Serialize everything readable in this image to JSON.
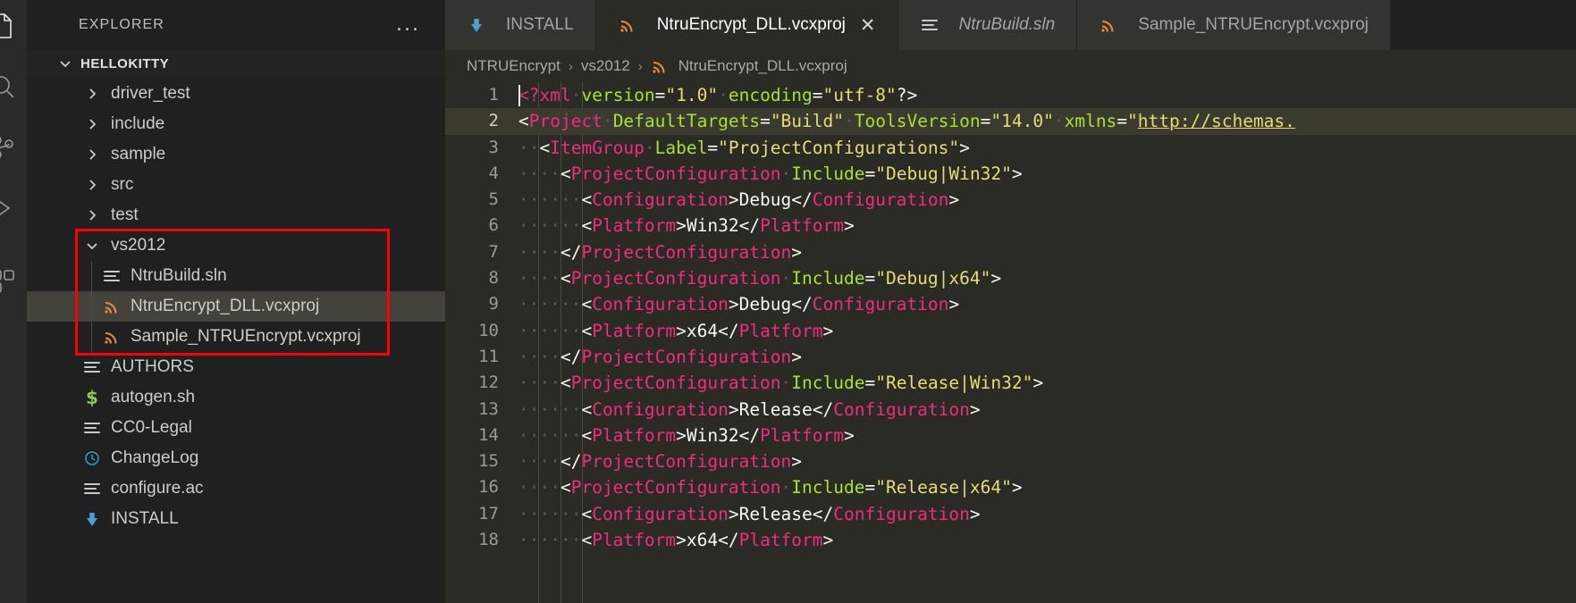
{
  "activity_bar": {
    "items": [
      {
        "name": "explorer-icon",
        "label": "Explorer"
      },
      {
        "name": "search-icon",
        "label": "Search"
      },
      {
        "name": "source-control-icon",
        "label": "Source Control"
      },
      {
        "name": "run-debug-icon",
        "label": "Run and Debug"
      },
      {
        "name": "extensions-icon",
        "label": "Extensions"
      }
    ]
  },
  "sidebar": {
    "title": "EXPLORER",
    "more_actions": "...",
    "root_folder": "HELLOKITTY",
    "tree": [
      {
        "label": "driver_test",
        "icon": "chevron-right-icon",
        "type": "folder",
        "indent": 1,
        "expanded": false,
        "selected": false
      },
      {
        "label": "include",
        "icon": "chevron-right-icon",
        "type": "folder",
        "indent": 1,
        "expanded": false,
        "selected": false
      },
      {
        "label": "sample",
        "icon": "chevron-right-icon",
        "type": "folder",
        "indent": 1,
        "expanded": false,
        "selected": false
      },
      {
        "label": "src",
        "icon": "chevron-right-icon",
        "type": "folder",
        "indent": 1,
        "expanded": false,
        "selected": false
      },
      {
        "label": "test",
        "icon": "chevron-right-icon",
        "type": "folder",
        "indent": 1,
        "expanded": false,
        "selected": false
      },
      {
        "label": "vs2012",
        "icon": "chevron-down-icon",
        "type": "folder",
        "indent": 1,
        "expanded": true,
        "selected": false
      },
      {
        "label": "NtruBuild.sln",
        "icon": "lines-file-icon",
        "type": "file",
        "indent": 2,
        "selected": false
      },
      {
        "label": "NtruEncrypt_DLL.vcxproj",
        "icon": "rss-file-icon",
        "type": "file",
        "indent": 2,
        "selected": true
      },
      {
        "label": "Sample_NTRUEncrypt.vcxproj",
        "icon": "rss-file-icon",
        "type": "file",
        "indent": 2,
        "selected": false
      },
      {
        "label": "AUTHORS",
        "icon": "lines-file-icon",
        "type": "file",
        "indent": 1,
        "selected": false
      },
      {
        "label": "autogen.sh",
        "icon": "shell-dollar-icon",
        "type": "file",
        "indent": 1,
        "selected": false
      },
      {
        "label": "CC0-Legal",
        "icon": "lines-file-icon",
        "type": "file",
        "indent": 1,
        "selected": false
      },
      {
        "label": "ChangeLog",
        "icon": "clock-icon",
        "type": "file",
        "indent": 1,
        "selected": false
      },
      {
        "label": "configure.ac",
        "icon": "lines-file-icon",
        "type": "file",
        "indent": 1,
        "selected": false
      },
      {
        "label": "INSTALL",
        "icon": "down-arrow-icon",
        "type": "file",
        "indent": 1,
        "selected": false
      }
    ],
    "highlight_color": "#ff0000"
  },
  "tabs": [
    {
      "label": "INSTALL",
      "icon": "down-arrow-icon",
      "active": false,
      "italic": false,
      "closable": false
    },
    {
      "label": "NtruEncrypt_DLL.vcxproj",
      "icon": "rss-file-icon",
      "active": true,
      "italic": false,
      "closable": true,
      "close_glyph": "✕"
    },
    {
      "label": "NtruBuild.sln",
      "icon": "lines-file-icon",
      "active": false,
      "italic": true,
      "closable": false
    },
    {
      "label": "Sample_NTRUEncrypt.vcxproj",
      "icon": "rss-file-icon",
      "active": false,
      "italic": false,
      "closable": false
    }
  ],
  "breadcrumb": {
    "separator": "›",
    "items": [
      {
        "label": "NTRUEncrypt",
        "icon": null
      },
      {
        "label": "vs2012",
        "icon": null
      },
      {
        "label": "NtruEncrypt_DLL.vcxproj",
        "icon": "rss-file-icon"
      }
    ]
  },
  "editor": {
    "language": "xml",
    "cursor_line": 1,
    "highlighted_line": 2,
    "lines": [
      {
        "n": "1",
        "tokens": [
          {
            "t": "<?",
            "c": "tag"
          },
          {
            "t": "xml",
            "c": "tag"
          },
          {
            "t": "·",
            "c": "ws"
          },
          {
            "t": "version",
            "c": "attr"
          },
          {
            "t": "=",
            "c": "txt"
          },
          {
            "t": "\"1.0\"",
            "c": "val"
          },
          {
            "t": "·",
            "c": "ws"
          },
          {
            "t": "encoding",
            "c": "attr"
          },
          {
            "t": "=",
            "c": "txt"
          },
          {
            "t": "\"utf-8\"",
            "c": "val"
          },
          {
            "t": "?>",
            "c": "txt"
          }
        ]
      },
      {
        "n": "2",
        "tokens": [
          {
            "t": "<",
            "c": "txt"
          },
          {
            "t": "Project",
            "c": "tag"
          },
          {
            "t": "·",
            "c": "ws"
          },
          {
            "t": "DefaultTargets",
            "c": "attr"
          },
          {
            "t": "=",
            "c": "txt"
          },
          {
            "t": "\"Build\"",
            "c": "val"
          },
          {
            "t": "·",
            "c": "ws"
          },
          {
            "t": "ToolsVersion",
            "c": "attr"
          },
          {
            "t": "=",
            "c": "txt"
          },
          {
            "t": "\"14.0\"",
            "c": "val"
          },
          {
            "t": "·",
            "c": "ws"
          },
          {
            "t": "xmlns",
            "c": "attr"
          },
          {
            "t": "=",
            "c": "txt"
          },
          {
            "t": "\"",
            "c": "val"
          },
          {
            "t": "http://schemas.",
            "c": "link"
          }
        ]
      },
      {
        "n": "3",
        "tokens": [
          {
            "t": "··",
            "c": "ws"
          },
          {
            "t": "<",
            "c": "txt"
          },
          {
            "t": "ItemGroup",
            "c": "tag"
          },
          {
            "t": "·",
            "c": "ws"
          },
          {
            "t": "Label",
            "c": "attr"
          },
          {
            "t": "=",
            "c": "txt"
          },
          {
            "t": "\"ProjectConfigurations\"",
            "c": "val"
          },
          {
            "t": ">",
            "c": "txt"
          }
        ]
      },
      {
        "n": "4",
        "tokens": [
          {
            "t": "····",
            "c": "ws"
          },
          {
            "t": "<",
            "c": "txt"
          },
          {
            "t": "ProjectConfiguration",
            "c": "tag"
          },
          {
            "t": "·",
            "c": "ws"
          },
          {
            "t": "Include",
            "c": "attr"
          },
          {
            "t": "=",
            "c": "txt"
          },
          {
            "t": "\"Debug|Win32\"",
            "c": "val"
          },
          {
            "t": ">",
            "c": "txt"
          }
        ]
      },
      {
        "n": "5",
        "tokens": [
          {
            "t": "······",
            "c": "ws"
          },
          {
            "t": "<",
            "c": "txt"
          },
          {
            "t": "Configuration",
            "c": "tag"
          },
          {
            "t": ">",
            "c": "txt"
          },
          {
            "t": "Debug",
            "c": "txt"
          },
          {
            "t": "</",
            "c": "txt"
          },
          {
            "t": "Configuration",
            "c": "tag"
          },
          {
            "t": ">",
            "c": "txt"
          }
        ]
      },
      {
        "n": "6",
        "tokens": [
          {
            "t": "······",
            "c": "ws"
          },
          {
            "t": "<",
            "c": "txt"
          },
          {
            "t": "Platform",
            "c": "tag"
          },
          {
            "t": ">",
            "c": "txt"
          },
          {
            "t": "Win32",
            "c": "txt"
          },
          {
            "t": "</",
            "c": "txt"
          },
          {
            "t": "Platform",
            "c": "tag"
          },
          {
            "t": ">",
            "c": "txt"
          }
        ]
      },
      {
        "n": "7",
        "tokens": [
          {
            "t": "····",
            "c": "ws"
          },
          {
            "t": "</",
            "c": "txt"
          },
          {
            "t": "ProjectConfiguration",
            "c": "tag"
          },
          {
            "t": ">",
            "c": "txt"
          }
        ]
      },
      {
        "n": "8",
        "tokens": [
          {
            "t": "····",
            "c": "ws"
          },
          {
            "t": "<",
            "c": "txt"
          },
          {
            "t": "ProjectConfiguration",
            "c": "tag"
          },
          {
            "t": "·",
            "c": "ws"
          },
          {
            "t": "Include",
            "c": "attr"
          },
          {
            "t": "=",
            "c": "txt"
          },
          {
            "t": "\"Debug|x64\"",
            "c": "val"
          },
          {
            "t": ">",
            "c": "txt"
          }
        ]
      },
      {
        "n": "9",
        "tokens": [
          {
            "t": "······",
            "c": "ws"
          },
          {
            "t": "<",
            "c": "txt"
          },
          {
            "t": "Configuration",
            "c": "tag"
          },
          {
            "t": ">",
            "c": "txt"
          },
          {
            "t": "Debug",
            "c": "txt"
          },
          {
            "t": "</",
            "c": "txt"
          },
          {
            "t": "Configuration",
            "c": "tag"
          },
          {
            "t": ">",
            "c": "txt"
          }
        ]
      },
      {
        "n": "10",
        "tokens": [
          {
            "t": "······",
            "c": "ws"
          },
          {
            "t": "<",
            "c": "txt"
          },
          {
            "t": "Platform",
            "c": "tag"
          },
          {
            "t": ">",
            "c": "txt"
          },
          {
            "t": "x64",
            "c": "txt"
          },
          {
            "t": "</",
            "c": "txt"
          },
          {
            "t": "Platform",
            "c": "tag"
          },
          {
            "t": ">",
            "c": "txt"
          }
        ]
      },
      {
        "n": "11",
        "tokens": [
          {
            "t": "····",
            "c": "ws"
          },
          {
            "t": "</",
            "c": "txt"
          },
          {
            "t": "ProjectConfiguration",
            "c": "tag"
          },
          {
            "t": ">",
            "c": "txt"
          }
        ]
      },
      {
        "n": "12",
        "tokens": [
          {
            "t": "····",
            "c": "ws"
          },
          {
            "t": "<",
            "c": "txt"
          },
          {
            "t": "ProjectConfiguration",
            "c": "tag"
          },
          {
            "t": "·",
            "c": "ws"
          },
          {
            "t": "Include",
            "c": "attr"
          },
          {
            "t": "=",
            "c": "txt"
          },
          {
            "t": "\"Release|Win32\"",
            "c": "val"
          },
          {
            "t": ">",
            "c": "txt"
          }
        ]
      },
      {
        "n": "13",
        "tokens": [
          {
            "t": "······",
            "c": "ws"
          },
          {
            "t": "<",
            "c": "txt"
          },
          {
            "t": "Configuration",
            "c": "tag"
          },
          {
            "t": ">",
            "c": "txt"
          },
          {
            "t": "Release",
            "c": "txt"
          },
          {
            "t": "</",
            "c": "txt"
          },
          {
            "t": "Configuration",
            "c": "tag"
          },
          {
            "t": ">",
            "c": "txt"
          }
        ]
      },
      {
        "n": "14",
        "tokens": [
          {
            "t": "······",
            "c": "ws"
          },
          {
            "t": "<",
            "c": "txt"
          },
          {
            "t": "Platform",
            "c": "tag"
          },
          {
            "t": ">",
            "c": "txt"
          },
          {
            "t": "Win32",
            "c": "txt"
          },
          {
            "t": "</",
            "c": "txt"
          },
          {
            "t": "Platform",
            "c": "tag"
          },
          {
            "t": ">",
            "c": "txt"
          }
        ]
      },
      {
        "n": "15",
        "tokens": [
          {
            "t": "····",
            "c": "ws"
          },
          {
            "t": "</",
            "c": "txt"
          },
          {
            "t": "ProjectConfiguration",
            "c": "tag"
          },
          {
            "t": ">",
            "c": "txt"
          }
        ]
      },
      {
        "n": "16",
        "tokens": [
          {
            "t": "····",
            "c": "ws"
          },
          {
            "t": "<",
            "c": "txt"
          },
          {
            "t": "ProjectConfiguration",
            "c": "tag"
          },
          {
            "t": "·",
            "c": "ws"
          },
          {
            "t": "Include",
            "c": "attr"
          },
          {
            "t": "=",
            "c": "txt"
          },
          {
            "t": "\"Release|x64\"",
            "c": "val"
          },
          {
            "t": ">",
            "c": "txt"
          }
        ]
      },
      {
        "n": "17",
        "tokens": [
          {
            "t": "······",
            "c": "ws"
          },
          {
            "t": "<",
            "c": "txt"
          },
          {
            "t": "Configuration",
            "c": "tag"
          },
          {
            "t": ">",
            "c": "txt"
          },
          {
            "t": "Release",
            "c": "txt"
          },
          {
            "t": "</",
            "c": "txt"
          },
          {
            "t": "Configuration",
            "c": "tag"
          },
          {
            "t": ">",
            "c": "txt"
          }
        ]
      },
      {
        "n": "18",
        "tokens": [
          {
            "t": "······",
            "c": "ws"
          },
          {
            "t": "<",
            "c": "txt"
          },
          {
            "t": "Platform",
            "c": "tag"
          },
          {
            "t": ">",
            "c": "txt"
          },
          {
            "t": "x64",
            "c": "txt"
          },
          {
            "t": "</",
            "c": "txt"
          },
          {
            "t": "Platform",
            "c": "tag"
          },
          {
            "t": ">",
            "c": "txt"
          }
        ]
      }
    ]
  },
  "colors": {
    "sidebar_bg": "#202020",
    "editor_bg": "#2b2b26",
    "tab_inactive_bg": "#333330",
    "selection_bg": "#43433b",
    "tag": "#f12b7f",
    "attribute": "#a6e22e",
    "string": "#e6db74",
    "text": "#f8f8f2",
    "vcxproj_icon": "#e8883a",
    "shell_icon": "#8cc84b",
    "clock_icon": "#2e9fd0",
    "install_icon": "#4a9fd0"
  }
}
